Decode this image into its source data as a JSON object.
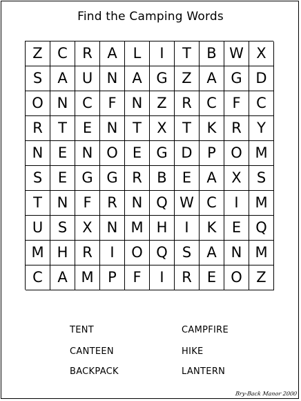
{
  "title": "Find the Camping Words",
  "grid": {
    "rows": [
      [
        "Z",
        "C",
        "R",
        "A",
        "L",
        "I",
        "T",
        "B",
        "W",
        "X"
      ],
      [
        "S",
        "A",
        "U",
        "N",
        "A",
        "G",
        "Z",
        "A",
        "G",
        "D"
      ],
      [
        "O",
        "N",
        "C",
        "F",
        "N",
        "Z",
        "R",
        "C",
        "F",
        "C"
      ],
      [
        "R",
        "T",
        "E",
        "N",
        "T",
        "X",
        "T",
        "K",
        "R",
        "Y"
      ],
      [
        "N",
        "E",
        "N",
        "O",
        "E",
        "G",
        "D",
        "P",
        "O",
        "M"
      ],
      [
        "S",
        "E",
        "G",
        "G",
        "R",
        "B",
        "E",
        "A",
        "X",
        "S"
      ],
      [
        "T",
        "N",
        "F",
        "R",
        "N",
        "Q",
        "W",
        "C",
        "I",
        "M"
      ],
      [
        "U",
        "S",
        "X",
        "N",
        "M",
        "H",
        "I",
        "K",
        "E",
        "Q"
      ],
      [
        "M",
        "H",
        "R",
        "I",
        "O",
        "Q",
        "S",
        "A",
        "N",
        "M"
      ],
      [
        "C",
        "A",
        "M",
        "P",
        "F",
        "I",
        "R",
        "E",
        "O",
        "Z"
      ]
    ]
  },
  "words": {
    "left": [
      "TENT",
      "CANTEEN",
      "BACKPACK"
    ],
    "right": [
      "CAMPFIRE",
      "HIKE",
      "LANTERN"
    ]
  },
  "signature": "Bry-Back Manor 2000"
}
